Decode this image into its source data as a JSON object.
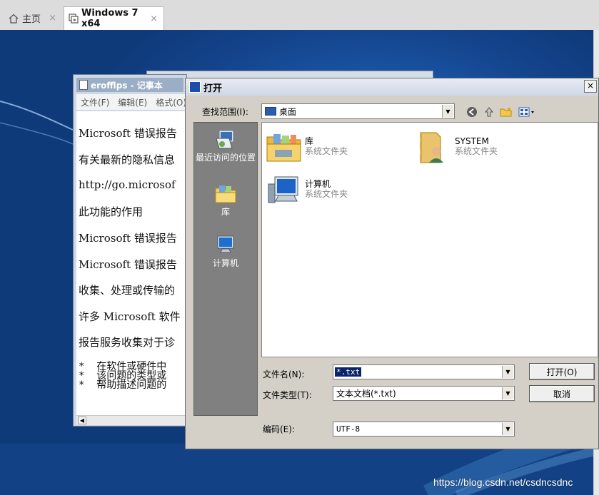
{
  "tabs": [
    {
      "label": "主页",
      "icon": "home-icon",
      "close": "×"
    },
    {
      "label": "Windows 7 x64",
      "icon": "vm-icon",
      "close": "×"
    }
  ],
  "watermark": "https://blog.csdn.net/csdncsdnc",
  "notepad": {
    "title": "erofflps - 记事本",
    "menu": [
      "文件(F)",
      "编辑(E)",
      "格式(O)"
    ],
    "lines": [
      "Microsoft 错误报告",
      "有关最新的隐私信息",
      "http://go.microsof",
      "此功能的作用",
      "Microsoft 错误报告",
      "Microsoft 错误报告",
      "收集、处理或传输的",
      "许多 Microsoft 软件",
      "报告服务收集对于诊"
    ],
    "bullets": [
      "*  在软件或硬件中",
      "*  该问题的类型或",
      "*  帮助描述问题的"
    ]
  },
  "dialog": {
    "title": "打开",
    "look_in_label": "查找范围(I):",
    "look_in_value": "桌面",
    "places": [
      {
        "label": "最近访问的位置",
        "icon": "recent-places-icon"
      },
      {
        "label": "库",
        "icon": "library-icon"
      },
      {
        "label": "计算机",
        "icon": "computer-icon"
      }
    ],
    "files": [
      {
        "name": "库",
        "type": "系统文件夹",
        "icon": "library-folder-icon"
      },
      {
        "name": "SYSTEM",
        "type": "系统文件夹",
        "icon": "user-folder-icon"
      },
      {
        "name": "计算机",
        "type": "系统文件夹",
        "icon": "computer-icon"
      }
    ],
    "filename_label": "文件名(N):",
    "filename_value": "*.txt",
    "filetype_label": "文件类型(T):",
    "filetype_value": "文本文档(*.txt)",
    "encoding_label": "编码(E):",
    "encoding_value": "UTF-8",
    "open_button": "打开(O)",
    "cancel_button": "取消",
    "close_glyph": "×"
  }
}
